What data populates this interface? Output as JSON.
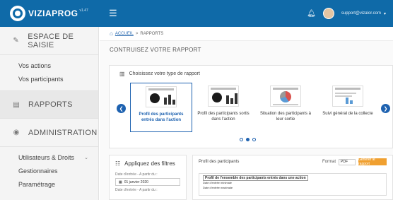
{
  "app": {
    "name": "VIZIAPROG",
    "sup": "v1.47"
  },
  "header": {
    "user_email": "support@vizalor.com"
  },
  "sidebar": {
    "sections": [
      {
        "label": "ESPACE DE SAISIE",
        "links": [
          "Vos actions",
          "Vos participants"
        ]
      },
      {
        "label": "RAPPORTS",
        "links": []
      },
      {
        "label": "ADMINISTRATION",
        "links": [
          "Utilisateurs & Droits",
          "Gestionnaires",
          "Paramétrage"
        ]
      }
    ]
  },
  "breadcrumb": {
    "link": "ACCUEIL",
    "sep": ">",
    "current": "RAPPORTS"
  },
  "page_title": "CONTRUISEZ VOTRE RAPPORT",
  "types_card": {
    "title": "Choisissez votre type de rapport",
    "tiles": [
      {
        "label": "Profil des participants entrés dans l'action",
        "selected": true
      },
      {
        "label": "Profil des participants sortis dans l'action",
        "selected": false
      },
      {
        "label": "Situation des participants à leur sortie",
        "selected": false
      },
      {
        "label": "Suivi général de la collecte",
        "selected": false
      }
    ],
    "page_dots": 3,
    "active_dot": 1
  },
  "filters": {
    "title": "Appliquez des filtres",
    "fields": [
      {
        "label": "Date d'entrée - A partir du :",
        "value": "01 janvier 2020"
      },
      {
        "label": "Date d'entrée - A partir du :",
        "value": ""
      }
    ]
  },
  "report": {
    "title": "Profil des participants",
    "format_label": "Format",
    "format_value": "PDF",
    "generate_label": "Générer le rapport",
    "preview_title": "Profil de l'ensemble des participants entrés dans une action",
    "preview_row1": "Date d'entrée minimale",
    "preview_row2": "Date d'entrée maximale"
  }
}
